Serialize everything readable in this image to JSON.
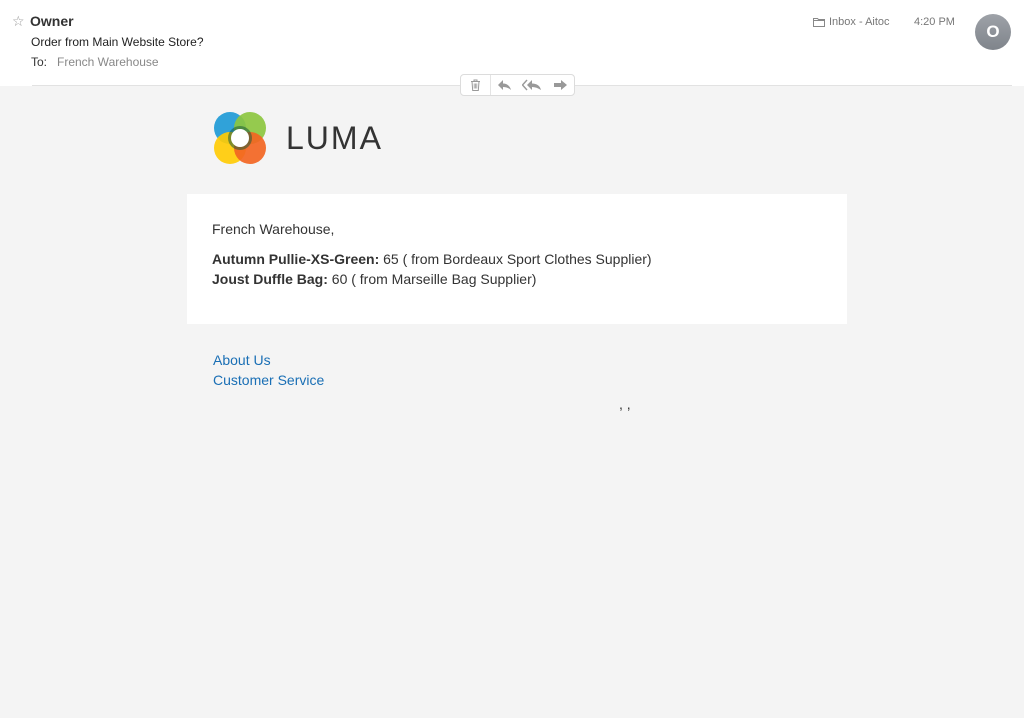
{
  "header": {
    "sender": "Owner",
    "subject": "Order from Main Website Store?",
    "to_label": "To:",
    "to_value": "French Warehouse",
    "folder": "Inbox - Aitoc",
    "time": "4:20 PM",
    "avatar_initial": "O"
  },
  "toolbar": {
    "actions": [
      "trash-icon",
      "reply-icon",
      "reply-all-icon",
      "forward-icon"
    ]
  },
  "email": {
    "logo_text": "LUMA",
    "greeting": "French Warehouse,",
    "items": [
      {
        "name": "Autumn Pullie-XS-Green:",
        "detail": " 65 ( from Bordeaux Sport Clothes Supplier)"
      },
      {
        "name": "Joust Duffle Bag:",
        "detail": " 60 ( from Marseille Bag Supplier)"
      }
    ],
    "footer_links": [
      "About Us",
      "Customer Service"
    ],
    "footer_text": ", ,"
  },
  "colors": {
    "link": "#1a6fb5",
    "avatar": "#8b9096",
    "background": "#f4f4f4"
  }
}
